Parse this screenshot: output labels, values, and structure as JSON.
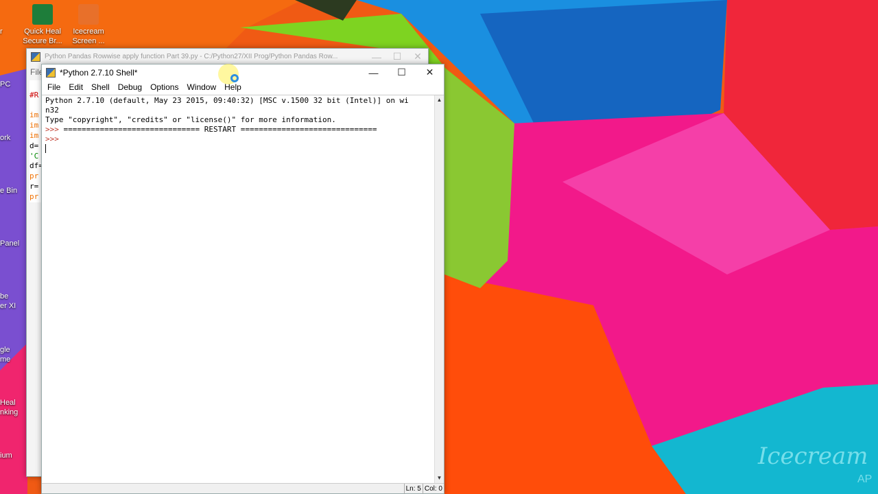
{
  "desktop": {
    "icons": [
      {
        "label_line1": "Quick Heal",
        "label_line2": "Secure Br...",
        "color": "#1e7d3a"
      },
      {
        "label_line1": "Icecream",
        "label_line2": "Screen ...",
        "color": "#e8702a"
      }
    ],
    "partial_labels": [
      "r",
      "PC",
      "ork",
      "e Bin",
      "Panel",
      "be",
      "er XI",
      "gle",
      "me",
      "Heal",
      "nking",
      "ium"
    ],
    "watermark": "Icecream",
    "watermark_sub": "AP"
  },
  "back_window": {
    "title": "Python Pandas Rowwise apply function Part 39.py - C:/Python27/XII Prog/Python Pandas Row...",
    "menu_first": "File",
    "code_fragments": [
      "#R",
      "im",
      "im",
      "im",
      "d=",
      "'C",
      "df=",
      "pr",
      "r=",
      "pr"
    ]
  },
  "shell": {
    "title": "*Python 2.7.10 Shell*",
    "menu": [
      "File",
      "Edit",
      "Shell",
      "Debug",
      "Options",
      "Window",
      "Help"
    ],
    "lines": {
      "l1": "Python 2.7.10 (default, May 23 2015, 09:40:32) [MSC v.1500 32 bit (Intel)] on wi",
      "l2": "n32",
      "l3": "Type \"copyright\", \"credits\" or \"license()\" for more information.",
      "prompt": ">>> ",
      "restart": "============================== RESTART ==============================",
      "prompt2": ">>>"
    },
    "status": {
      "ln": "Ln: 5",
      "col": "Col: 0"
    }
  }
}
